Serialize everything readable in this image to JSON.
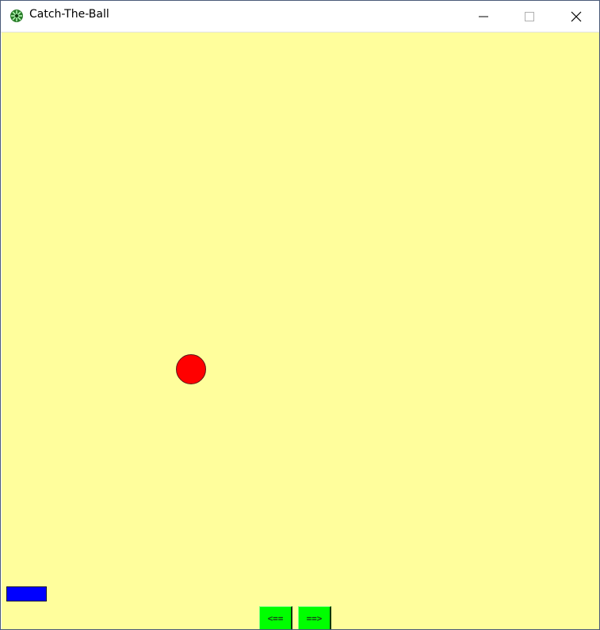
{
  "window": {
    "title": "Catch-The-Ball",
    "icon": "feather-icon",
    "controls": [
      "minimize-icon",
      "maximize-icon",
      "close-icon"
    ]
  },
  "game": {
    "background_color": "#fffe9c",
    "ball_color": "#ff0000",
    "paddle_color": "#0000ff",
    "button_color": "#00ff00",
    "left_button_label": "<==",
    "right_button_label": "==>"
  }
}
